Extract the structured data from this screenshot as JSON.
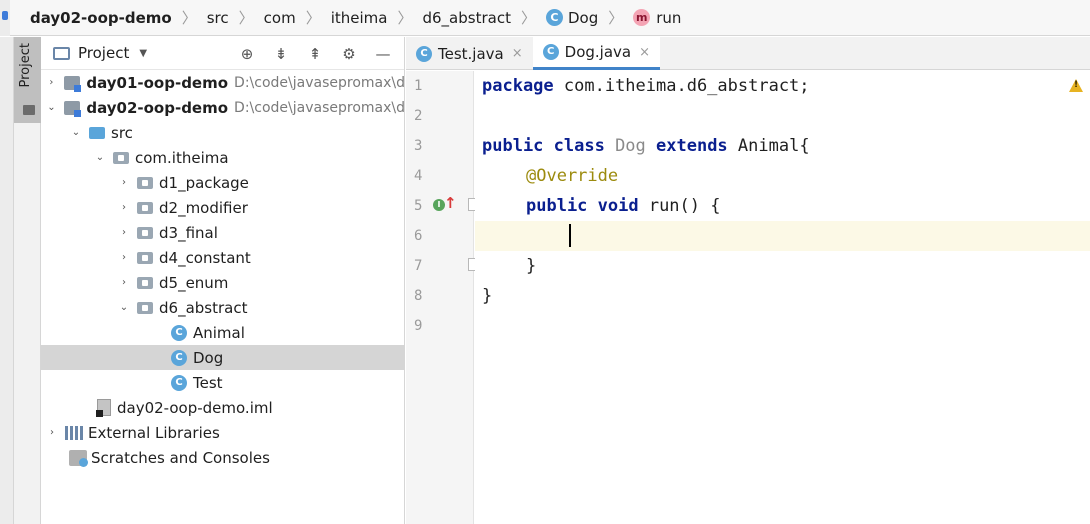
{
  "breadcrumb": {
    "project": "day02-oop-demo",
    "src": "src",
    "com": "com",
    "itheima": "itheima",
    "pkg": "d6_abstract",
    "cls_icon": "C",
    "cls": "Dog",
    "method_icon": "m",
    "method": "run"
  },
  "side": {
    "project_tab": "Project"
  },
  "project_panel": {
    "title": "Project",
    "tools": [
      "⊕",
      "⇟",
      "⇞",
      "⚙",
      "—"
    ]
  },
  "tree": [
    {
      "name": "day01-oop-demo",
      "path": "D:\\code\\javasepromax\\d",
      "arrow": "›",
      "bold": true
    },
    {
      "name": "day02-oop-demo",
      "path": "D:\\code\\javasepromax\\d",
      "arrow": "⌄",
      "bold": true
    },
    {
      "name": "src",
      "arrow": "⌄"
    },
    {
      "name": "com.itheima",
      "arrow": "⌄"
    },
    {
      "name": "d1_package",
      "arrow": "›"
    },
    {
      "name": "d2_modifier",
      "arrow": "›"
    },
    {
      "name": "d3_final",
      "arrow": "›"
    },
    {
      "name": "d4_constant",
      "arrow": "›"
    },
    {
      "name": "d5_enum",
      "arrow": "›"
    },
    {
      "name": "d6_abstract",
      "arrow": "⌄"
    },
    {
      "name": "Animal",
      "icon": "C"
    },
    {
      "name": "Dog",
      "icon": "C"
    },
    {
      "name": "Test",
      "icon": "C"
    },
    {
      "name": "day02-oop-demo.iml"
    },
    {
      "name": "External Libraries",
      "arrow": "›"
    },
    {
      "name": "Scratches and Consoles"
    }
  ],
  "tabs": [
    {
      "label": "Test.java",
      "close": "×"
    },
    {
      "label": "Dog.java",
      "close": "×"
    }
  ],
  "line_numbers": [
    "1",
    "2",
    "3",
    "4",
    "5",
    "6",
    "7",
    "8",
    "9"
  ],
  "code": {
    "l1_kw": "package",
    "l1_rest": " com.itheima.d6_abstract;",
    "l3_kw1": "public class",
    "l3_name": " Dog ",
    "l3_kw2": "extends",
    "l3_rest": " Animal{",
    "l4_ann": "@Override",
    "l5_kw": "public void",
    "l5_rest": " run() {",
    "l7": "}",
    "l8": "}"
  },
  "gutter_marks": {
    "implements_icon": "I",
    "up_arrow": "↑"
  }
}
